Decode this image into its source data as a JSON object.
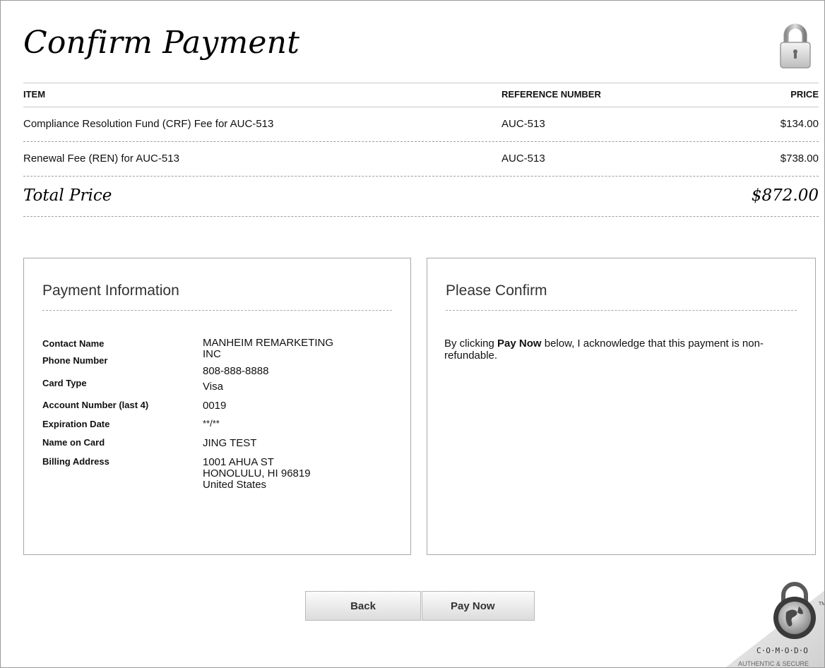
{
  "page": {
    "title": "Confirm Payment"
  },
  "items_table": {
    "headers": {
      "item": "ITEM",
      "reference": "REFERENCE NUMBER",
      "price": "PRICE"
    },
    "rows": [
      {
        "item": "Compliance Resolution Fund (CRF) Fee for AUC-513",
        "reference": "AUC-513",
        "price": "$134.00"
      },
      {
        "item": "Renewal Fee (REN) for AUC-513",
        "reference": "AUC-513",
        "price": "$738.00"
      }
    ],
    "total": {
      "label": "Total Price",
      "value": "$872.00"
    }
  },
  "payment_info": {
    "title": "Payment Information",
    "fields": [
      {
        "label": "Contact Name",
        "value_lines": [
          "MANHEIM REMARKETING",
          "INC"
        ]
      },
      {
        "label": "Phone Number",
        "value_lines": [
          "808-888-8888"
        ]
      },
      {
        "label": "Card Type",
        "value_lines": [
          "Visa"
        ]
      },
      {
        "label": "Account Number (last 4)",
        "value_lines": [
          "0019"
        ]
      },
      {
        "label": "Expiration Date",
        "value_lines": [
          "**/**"
        ]
      },
      {
        "label": "Name on Card",
        "value_lines": [
          "JING TEST"
        ]
      },
      {
        "label": "Billing Address",
        "value_lines": [
          "1001 AHUA ST",
          "HONOLULU, HI 96819",
          "United States"
        ]
      }
    ]
  },
  "confirm": {
    "title": "Please Confirm",
    "text_before": "By clicking ",
    "text_bold": "Pay Now",
    "text_after": " below, I acknowledge that this payment is non-refundable."
  },
  "buttons": {
    "back": "Back",
    "pay_now": "Pay Now"
  },
  "seal": {
    "brand": "C·O·M·O·D·O",
    "tagline": "AUTHENTIC & SECURE",
    "tm": "TM"
  },
  "icons": {
    "lock": "lock-icon",
    "seal": "comodo-seal-icon"
  },
  "colors": {
    "divider": "#9f9f9f",
    "panel_border": "#a8a8a8",
    "button_top": "#fbfbfb",
    "button_bottom": "#dcdcdc"
  }
}
